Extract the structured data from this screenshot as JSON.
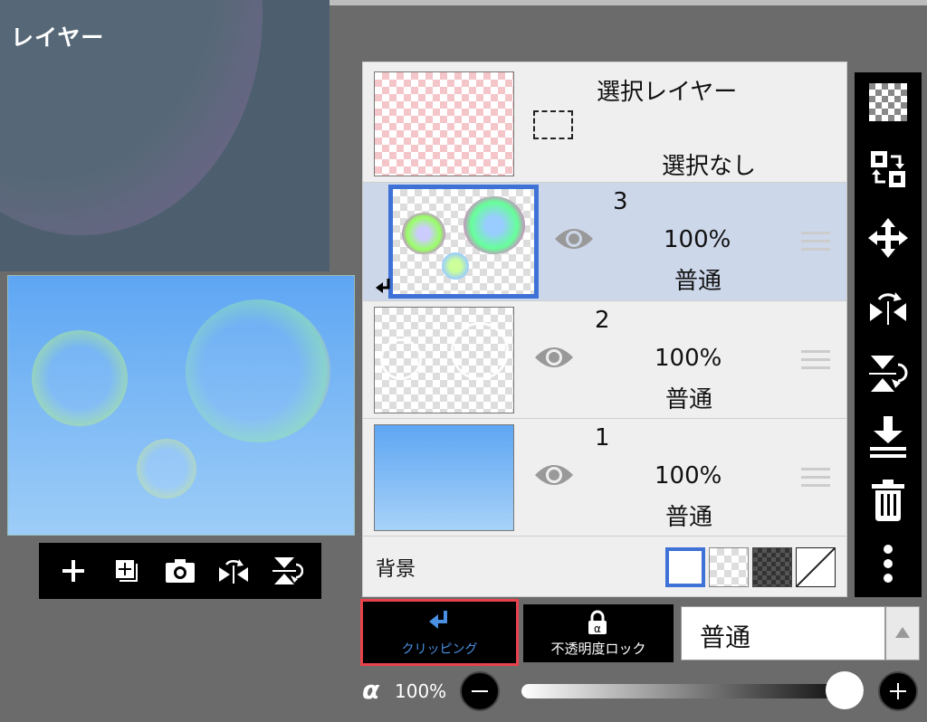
{
  "header": {
    "title": "レイヤー"
  },
  "preview_toolbar": {
    "icons": [
      "plus-icon",
      "add-layer-icon",
      "camera-icon",
      "flip-horizontal-icon",
      "flip-vertical-icon"
    ]
  },
  "layers": {
    "selection_layer": {
      "label": "選択レイヤー",
      "status": "選択なし"
    },
    "items": [
      {
        "name": "3",
        "opacity": "100%",
        "blend": "普通",
        "selected": true,
        "clipped": true
      },
      {
        "name": "2",
        "opacity": "100%",
        "blend": "普通",
        "selected": false,
        "clipped": false
      },
      {
        "name": "1",
        "opacity": "100%",
        "blend": "普通",
        "selected": false,
        "clipped": false
      }
    ],
    "background": {
      "label": "背景",
      "options": [
        "white",
        "checker-light",
        "checker-dark",
        "none"
      ],
      "selected": "white"
    }
  },
  "right_toolbar": {
    "icons": [
      "checker-icon",
      "swap-icon",
      "move-icon",
      "flip-horizontal-icon",
      "flip-vertical-icon",
      "merge-down-icon",
      "trash-icon",
      "more-icon"
    ]
  },
  "controls": {
    "clipping_label": "クリッピング",
    "opacity_lock_label": "不透明度ロック",
    "blend_mode": "普通"
  },
  "opacity": {
    "symbol": "α",
    "value": "100%",
    "level": 1.0
  },
  "colors": {
    "accent": "#3f72d6",
    "clip_highlight": "#e8424b",
    "clip_icon": "#4a90e2"
  }
}
